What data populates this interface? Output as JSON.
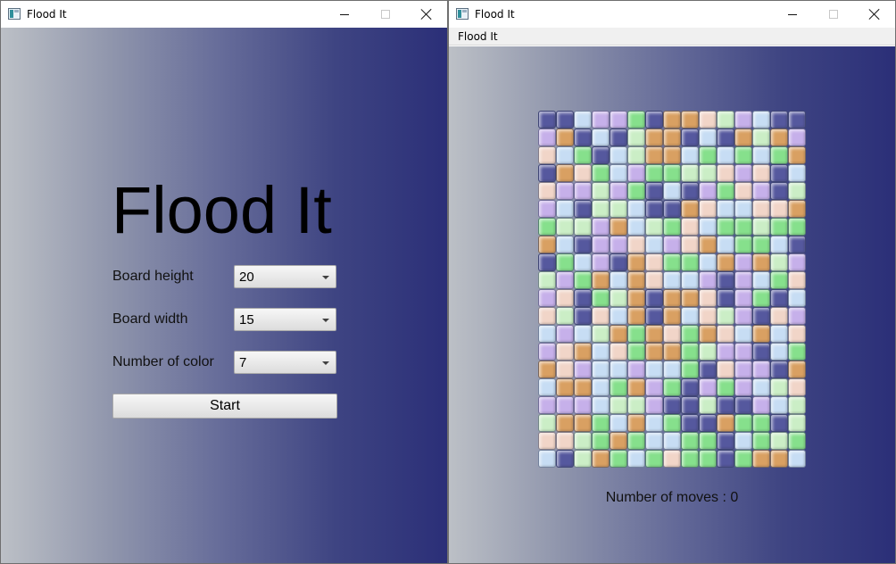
{
  "left_window": {
    "title": "Flood It",
    "heading": "Flood It",
    "form": {
      "board_height_label": "Board height",
      "board_height_value": "20",
      "board_width_label": "Board width",
      "board_width_value": "15",
      "num_colors_label": "Number of color",
      "num_colors_value": "7"
    },
    "start_label": "Start"
  },
  "right_window": {
    "title": "Flood It",
    "menu_label": "Flood It",
    "moves_text": "Number of moves : 0",
    "board": {
      "rows": 20,
      "cols": 15,
      "palette": {
        "N": "#55589e",
        "O": "#d9a062",
        "L": "#c7ddf4",
        "P": "#c6b0ea",
        "G": "#86e08c",
        "M": "#cbeec6",
        "K": "#f1d5c8"
      },
      "cells": [
        "NNLPPGNOOKMPLNN",
        "PONLNMOONLNOMO",
        "KLGNLMOOLGLGLGO",
        "NOKGLPGGMMKPKN",
        "KPPMPGNLNPGKP",
        "PLNMMLNNOKLLKK",
        "GMMPOLMGKLGGMG",
        "OLNPPKLPKOLGGLN",
        "NGLPNOKGGLOPOM",
        "MPGOLOKLLPNPLG",
        "PKNGMONOOKNPGN",
        "KMNKLONOLKMPNKP",
        "LPLMOGOKGOKLOLK",
        "PKOLKGOOGMPPNLG",
        "OKPLLPLLGNKPPNO",
        "LOOLGOPGNPGPLMK",
        "PPPLMMPNNMNNPLM",
        "MOOGLOLGNNOGGNM",
        "KKMGOGLLGGNLGMG",
        "LNMOGLGKGGNGOOL"
      ]
    }
  }
}
